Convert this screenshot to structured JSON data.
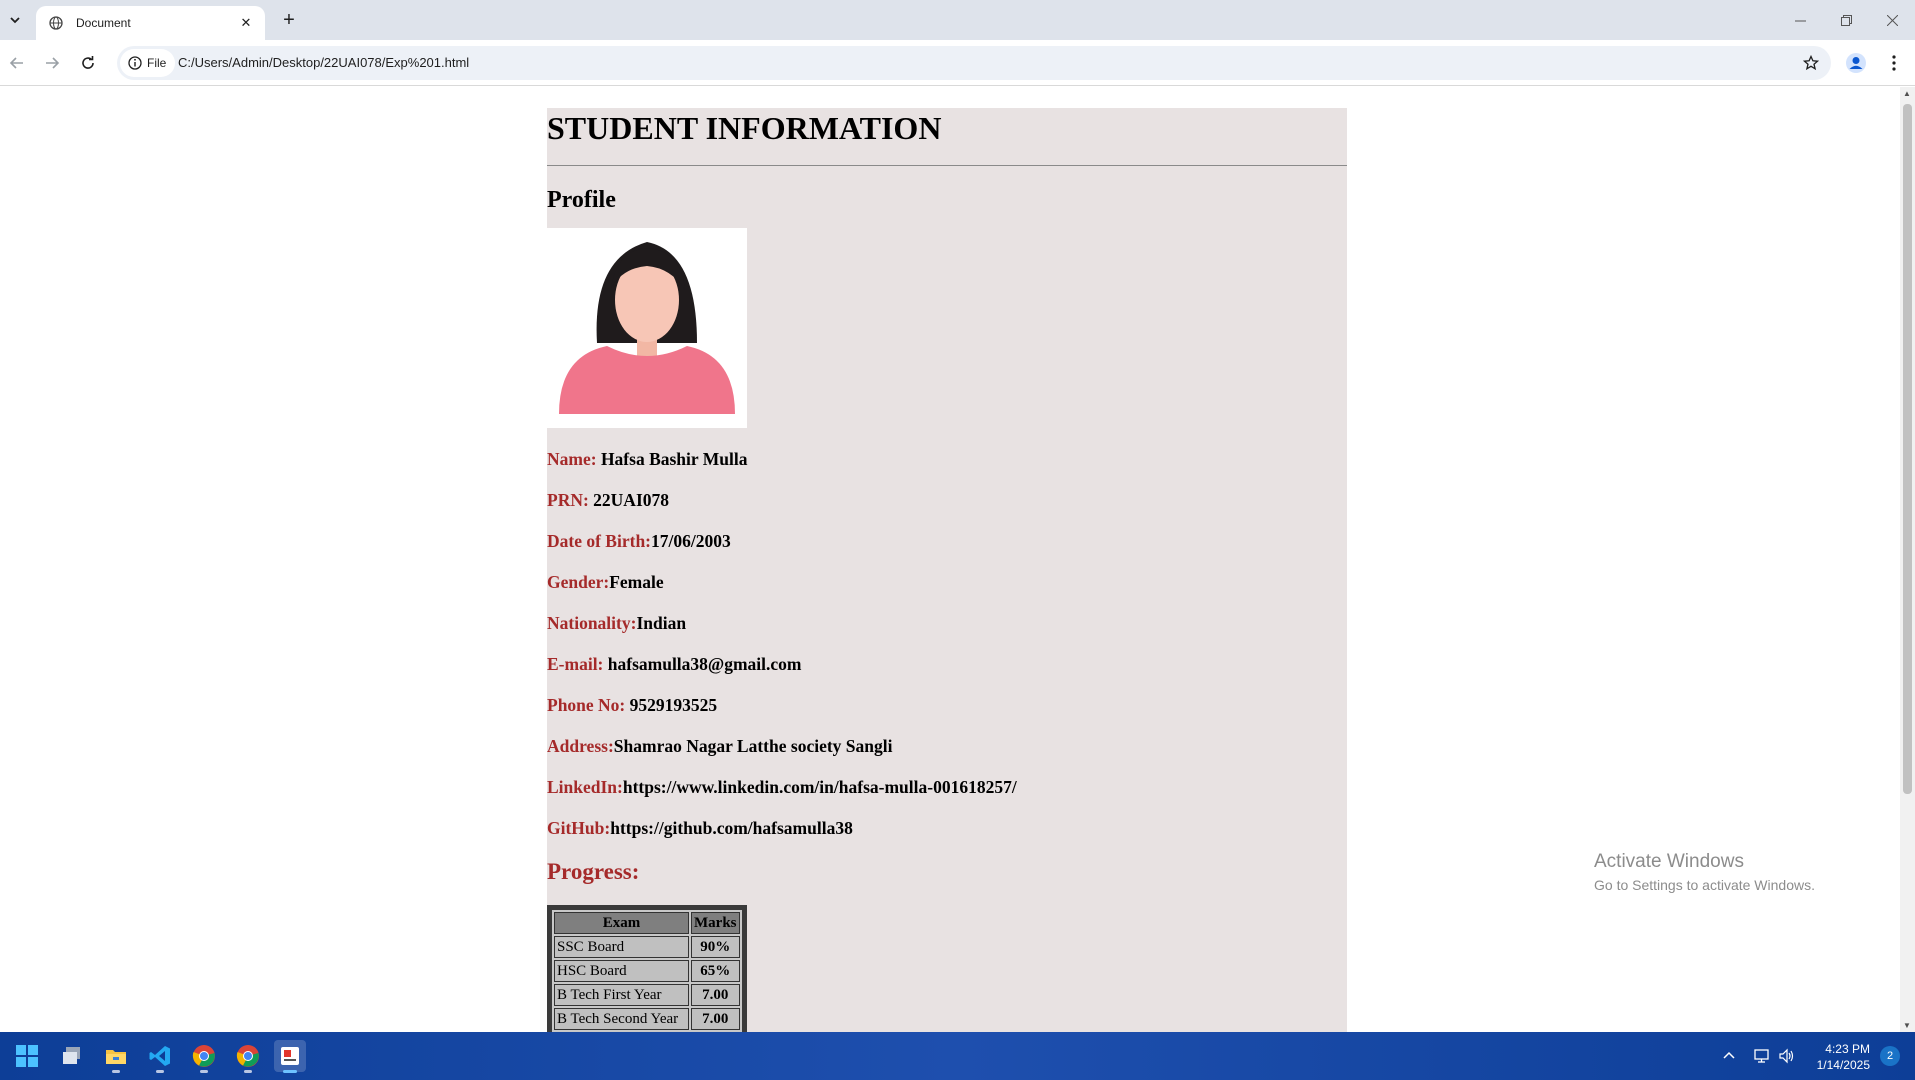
{
  "browser": {
    "tab_title": "Document",
    "address_chip": "File",
    "url": "C:/Users/Admin/Desktop/22UAI078/Exp%201.html"
  },
  "page": {
    "heading": "STUDENT INFORMATION",
    "profile_heading": "Profile",
    "fields": [
      {
        "label": "Name:",
        "value": " Hafsa Bashir Mulla"
      },
      {
        "label": "PRN:",
        "value": " 22UAI078"
      },
      {
        "label": "Date of Birth:",
        "value": "17/06/2003"
      },
      {
        "label": "Gender:",
        "value": "Female"
      },
      {
        "label": "Nationality:",
        "value": "Indian"
      },
      {
        "label": "E-mail:",
        "value": " hafsamulla38@gmail.com"
      },
      {
        "label": "Phone No:",
        "value": " 9529193525"
      },
      {
        "label": "Address:",
        "value": "Shamrao Nagar Latthe society Sangli"
      },
      {
        "label": "LinkedIn:",
        "value": "https://www.linkedin.com/in/hafsa-mulla-001618257/"
      },
      {
        "label": "GitHub:",
        "value": "https://github.com/hafsamulla38"
      }
    ],
    "progress_heading": "Progress:",
    "table": {
      "headers": [
        "Exam",
        "Marks"
      ],
      "rows": [
        [
          "SSC Board",
          "90%"
        ],
        [
          "HSC Board",
          "65%"
        ],
        [
          "B Tech First Year",
          "7.00"
        ],
        [
          "B Tech Second Year",
          "7.00"
        ]
      ]
    }
  },
  "watermark": {
    "line1": "Activate Windows",
    "line2": "Go to Settings to activate Windows."
  },
  "taskbar": {
    "time": "4:23 PM",
    "date": "1/14/2025",
    "notification_count": "2"
  },
  "colors": {
    "label": "#a52a2a",
    "page_bg": "#e8e2e2",
    "taskbar": "#1e4fae"
  }
}
